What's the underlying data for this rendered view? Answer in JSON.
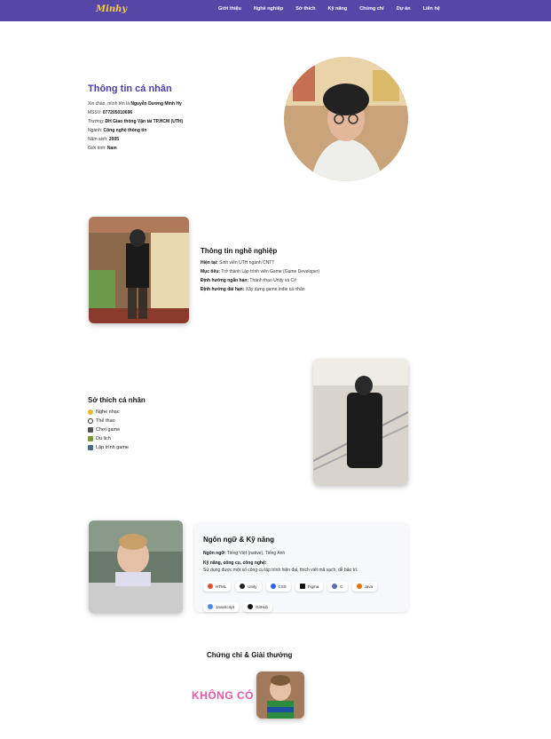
{
  "nav": {
    "logo": "Minhy",
    "links": [
      "Giới thiệu",
      "Nghề nghiệp",
      "Sở thích",
      "Kỹ năng",
      "Chứng chỉ",
      "Dự án",
      "Liên hệ"
    ]
  },
  "personal": {
    "title": "Thông tin cá nhân",
    "greeting_prefix": "Xin chào, mình tên là ",
    "name": "Nguyễn Dương Minh Hy",
    "mssv_label": "MSSV: ",
    "mssv": "077205010696",
    "school_label": "Trường: ",
    "school": "ĐH Giao thông Vận tải TP.HCM (UTH)",
    "major_label": "Ngành: ",
    "major": "Công nghệ thông tin",
    "birth_label": "Năm sinh: ",
    "birth": "2005",
    "gender_label": "Giới tính: ",
    "gender": "Nam"
  },
  "career": {
    "title": "Thông tin nghề nghiệp",
    "now_label": "Hiện tại:",
    "now": " Sinh viên UTH ngành CNTT",
    "goal_label": "Mục tiêu:",
    "goal": " Trở thành Lập trình viên Game (Game Developer)",
    "short_label": "Định hướng ngắn hạn:",
    "short": " Thành thạo Unity và C#",
    "long_label": "Định hướng dài hạn:",
    "long": " Xây dựng game indie cá nhân"
  },
  "hobbies": {
    "title": "Sở thích cá nhân",
    "items": [
      {
        "label": "Nghe nhạc",
        "icon": "lightbulb-icon",
        "color": "#e8b730"
      },
      {
        "label": "Thể thao",
        "icon": "soccer-ball-icon",
        "color": "#333333"
      },
      {
        "label": "Chơi game",
        "icon": "gamepad-icon",
        "color": "#555555"
      },
      {
        "label": "Du lịch",
        "icon": "mountain-icon",
        "color": "#7a9a3a"
      },
      {
        "label": "Lập trình game",
        "icon": "laptop-icon",
        "color": "#4a6a8a"
      }
    ]
  },
  "skills": {
    "title": "Ngôn ngữ & Kỹ năng",
    "lang_label": "Ngôn ngữ:",
    "lang": " Tiếng Việt (native), Tiếng Anh",
    "tools_label": "Kỹ năng, công cụ, công nghệ:",
    "tools_desc": "Sử dụng được một số công cụ lập trình hiện đại, thích viết mã sạch, dễ bảo trì.",
    "chips": [
      {
        "label": "HTML",
        "icon": "html-icon",
        "color": "#e44d26"
      },
      {
        "label": "Unity",
        "icon": "unity-icon",
        "color": "#222222"
      },
      {
        "label": "CSS",
        "icon": "css-icon",
        "color": "#2965f1"
      },
      {
        "label": "Figma",
        "icon": "figma-icon",
        "color": "#111111"
      },
      {
        "label": "C",
        "icon": "c-icon",
        "color": "#5c6bc0"
      },
      {
        "label": "Java",
        "icon": "java-icon",
        "color": "#e76f00"
      },
      {
        "label": "JavaScript",
        "icon": "javascript-icon",
        "color": "#4c8bf5"
      },
      {
        "label": "GitHub",
        "icon": "github-icon",
        "color": "#111111"
      }
    ]
  },
  "certs": {
    "title": "Chứng chỉ & Giải thưởng",
    "none": "KHÔNG CÓ"
  }
}
